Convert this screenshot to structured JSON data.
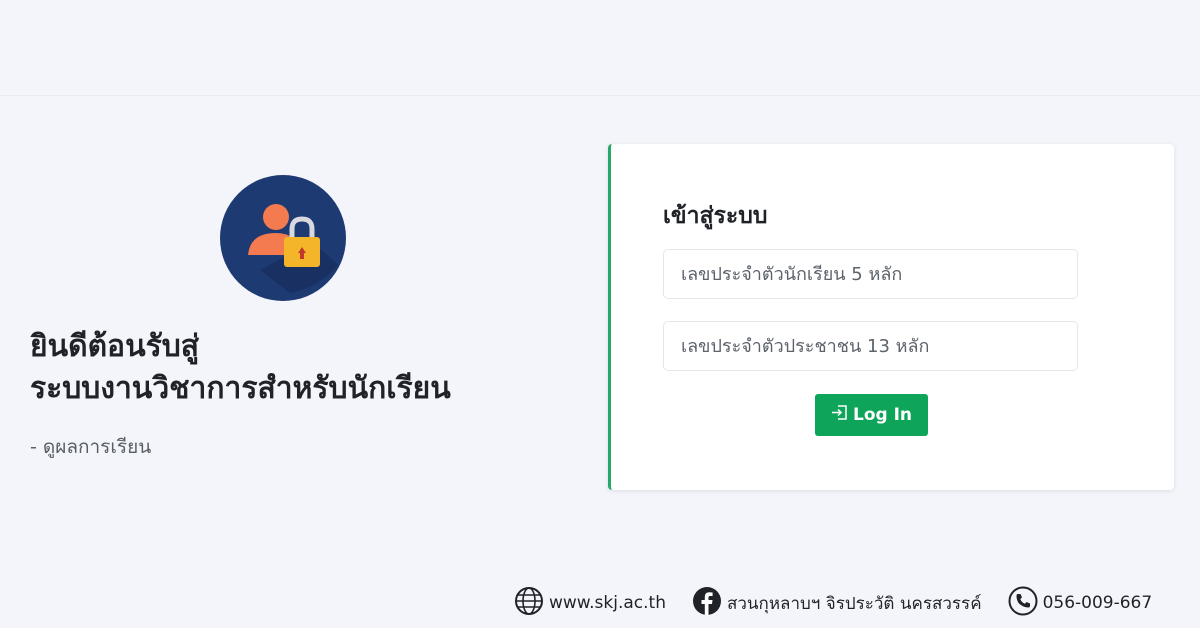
{
  "welcome": {
    "line1": "ยินดีต้อนรับสู่",
    "line2": "ระบบงานวิชาการสำหรับนักเรียน",
    "subtext": "- ดูผลการเรียน"
  },
  "login": {
    "title": "เข้าสู่ระบบ",
    "student_id_placeholder": "เลขประจำตัวนักเรียน 5 หลัก",
    "citizen_id_placeholder": "เลขประจำตัวประชาชน 13 หลัก",
    "button_label": "Log In",
    "button_icon": "login-arrow-icon"
  },
  "footer": {
    "website": "www.skj.ac.th",
    "facebook": "สวนกุหลาบฯ จิรประวัติ นครสวรรค์",
    "phone": "056-009-667"
  },
  "colors": {
    "accent": "#0ea55a",
    "card_border": "#28a868",
    "background": "#f4f5fa",
    "logo_circle": "#1e3a73",
    "logo_person": "#f47a4f",
    "logo_lock": "#f5b52a"
  }
}
